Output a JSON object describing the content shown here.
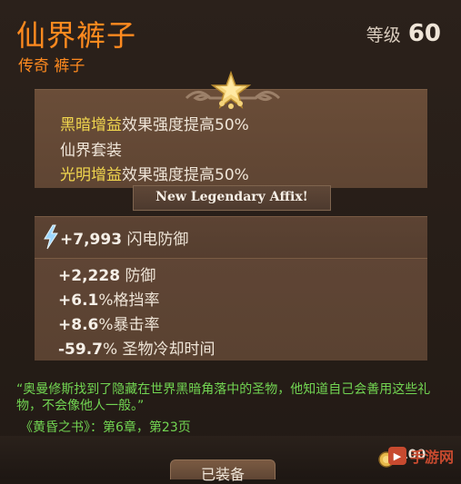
{
  "item": {
    "name": "仙界裤子",
    "subtitle": "传奇 裤子",
    "level_label": "等级",
    "level_value": "60"
  },
  "legendary": {
    "line1_highlight": "黑暗增益",
    "line1_text": "效果强度提高50%",
    "line2_highlight": "仙界套装",
    "line3_highlight": "光明增益",
    "line3_text": "效果强度提高50%"
  },
  "banner": {
    "text": "New Legendary Affix!"
  },
  "primary_stat": {
    "value": "+7,993",
    "label": "闪电防御",
    "icon": "lightning-bolt-icon"
  },
  "stats": [
    {
      "value": "+2,228",
      "label": "防御"
    },
    {
      "value": "+6.1",
      "label": "%格挡率"
    },
    {
      "value": "+8.6",
      "label": "%暴击率"
    },
    {
      "value": "-59.7",
      "label": "% 圣物冷却时间"
    }
  ],
  "lore": {
    "text": "“奥曼修斯找到了隐藏在世界黑暗角落中的圣物，他知道自己会善用这些礼物，不会像他人一般。”",
    "reference": "《黄昏之书》：第6章，第23页"
  },
  "footer": {
    "coin_value": "100",
    "coin_icon": "gold-coin-icon",
    "equip_label": "已装备",
    "watermark_text": "手游网"
  },
  "colors": {
    "legendary_orange": "#ff8a1f",
    "affix_yellow": "#f1d64e",
    "lore_green": "#72d552"
  }
}
